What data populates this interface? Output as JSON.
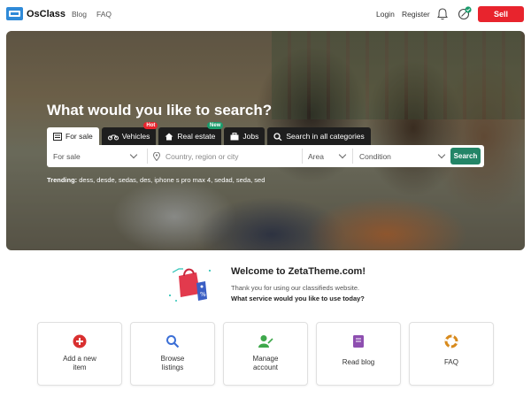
{
  "header": {
    "logo_text": "OsClass",
    "nav": [
      "Blog",
      "FAQ"
    ],
    "login": "Login",
    "register": "Register",
    "sell": "Sell",
    "icons": [
      "bell-icon",
      "message-icon"
    ],
    "accent": "#e8242d"
  },
  "hero": {
    "title": "What would you like to search?",
    "tabs": [
      {
        "label": "For sale",
        "icon": "listing-icon",
        "active": true
      },
      {
        "label": "Vehicles",
        "icon": "motorbike-icon",
        "badge": "Hot"
      },
      {
        "label": "Real estate",
        "icon": "home-icon",
        "badge": "New"
      },
      {
        "label": "Jobs",
        "icon": "briefcase-icon"
      },
      {
        "label": "Search in all categories",
        "icon": "search-icon"
      }
    ],
    "search": {
      "category_value": "For sale",
      "location_placeholder": "Country, region or city",
      "area_value": "Area",
      "condition_value": "Condition",
      "button": "Search",
      "button_color": "#238567"
    },
    "trending_label": "Trending:",
    "trending_terms": "dess, desde, sedas, des, iphone s pro max 4, sedad, seda, sed"
  },
  "welcome": {
    "title": "Welcome to ZetaTheme.com!",
    "subtitle": "Thank you for using our classifieds website.",
    "question": "What service would you like to use today?"
  },
  "cards": [
    {
      "label": "Add a new\nitem",
      "icon": "plus-circle-icon",
      "color": "#d93030"
    },
    {
      "label": "Browse\nlistings",
      "icon": "search-icon",
      "color": "#3b6fd6"
    },
    {
      "label": "Manage\naccount",
      "icon": "user-icon",
      "color": "#3ea84b"
    },
    {
      "label": "Read blog",
      "icon": "book-icon",
      "color": "#8e4fb0"
    },
    {
      "label": "FAQ",
      "icon": "lifebuoy-icon",
      "color": "#d88a1c"
    }
  ]
}
